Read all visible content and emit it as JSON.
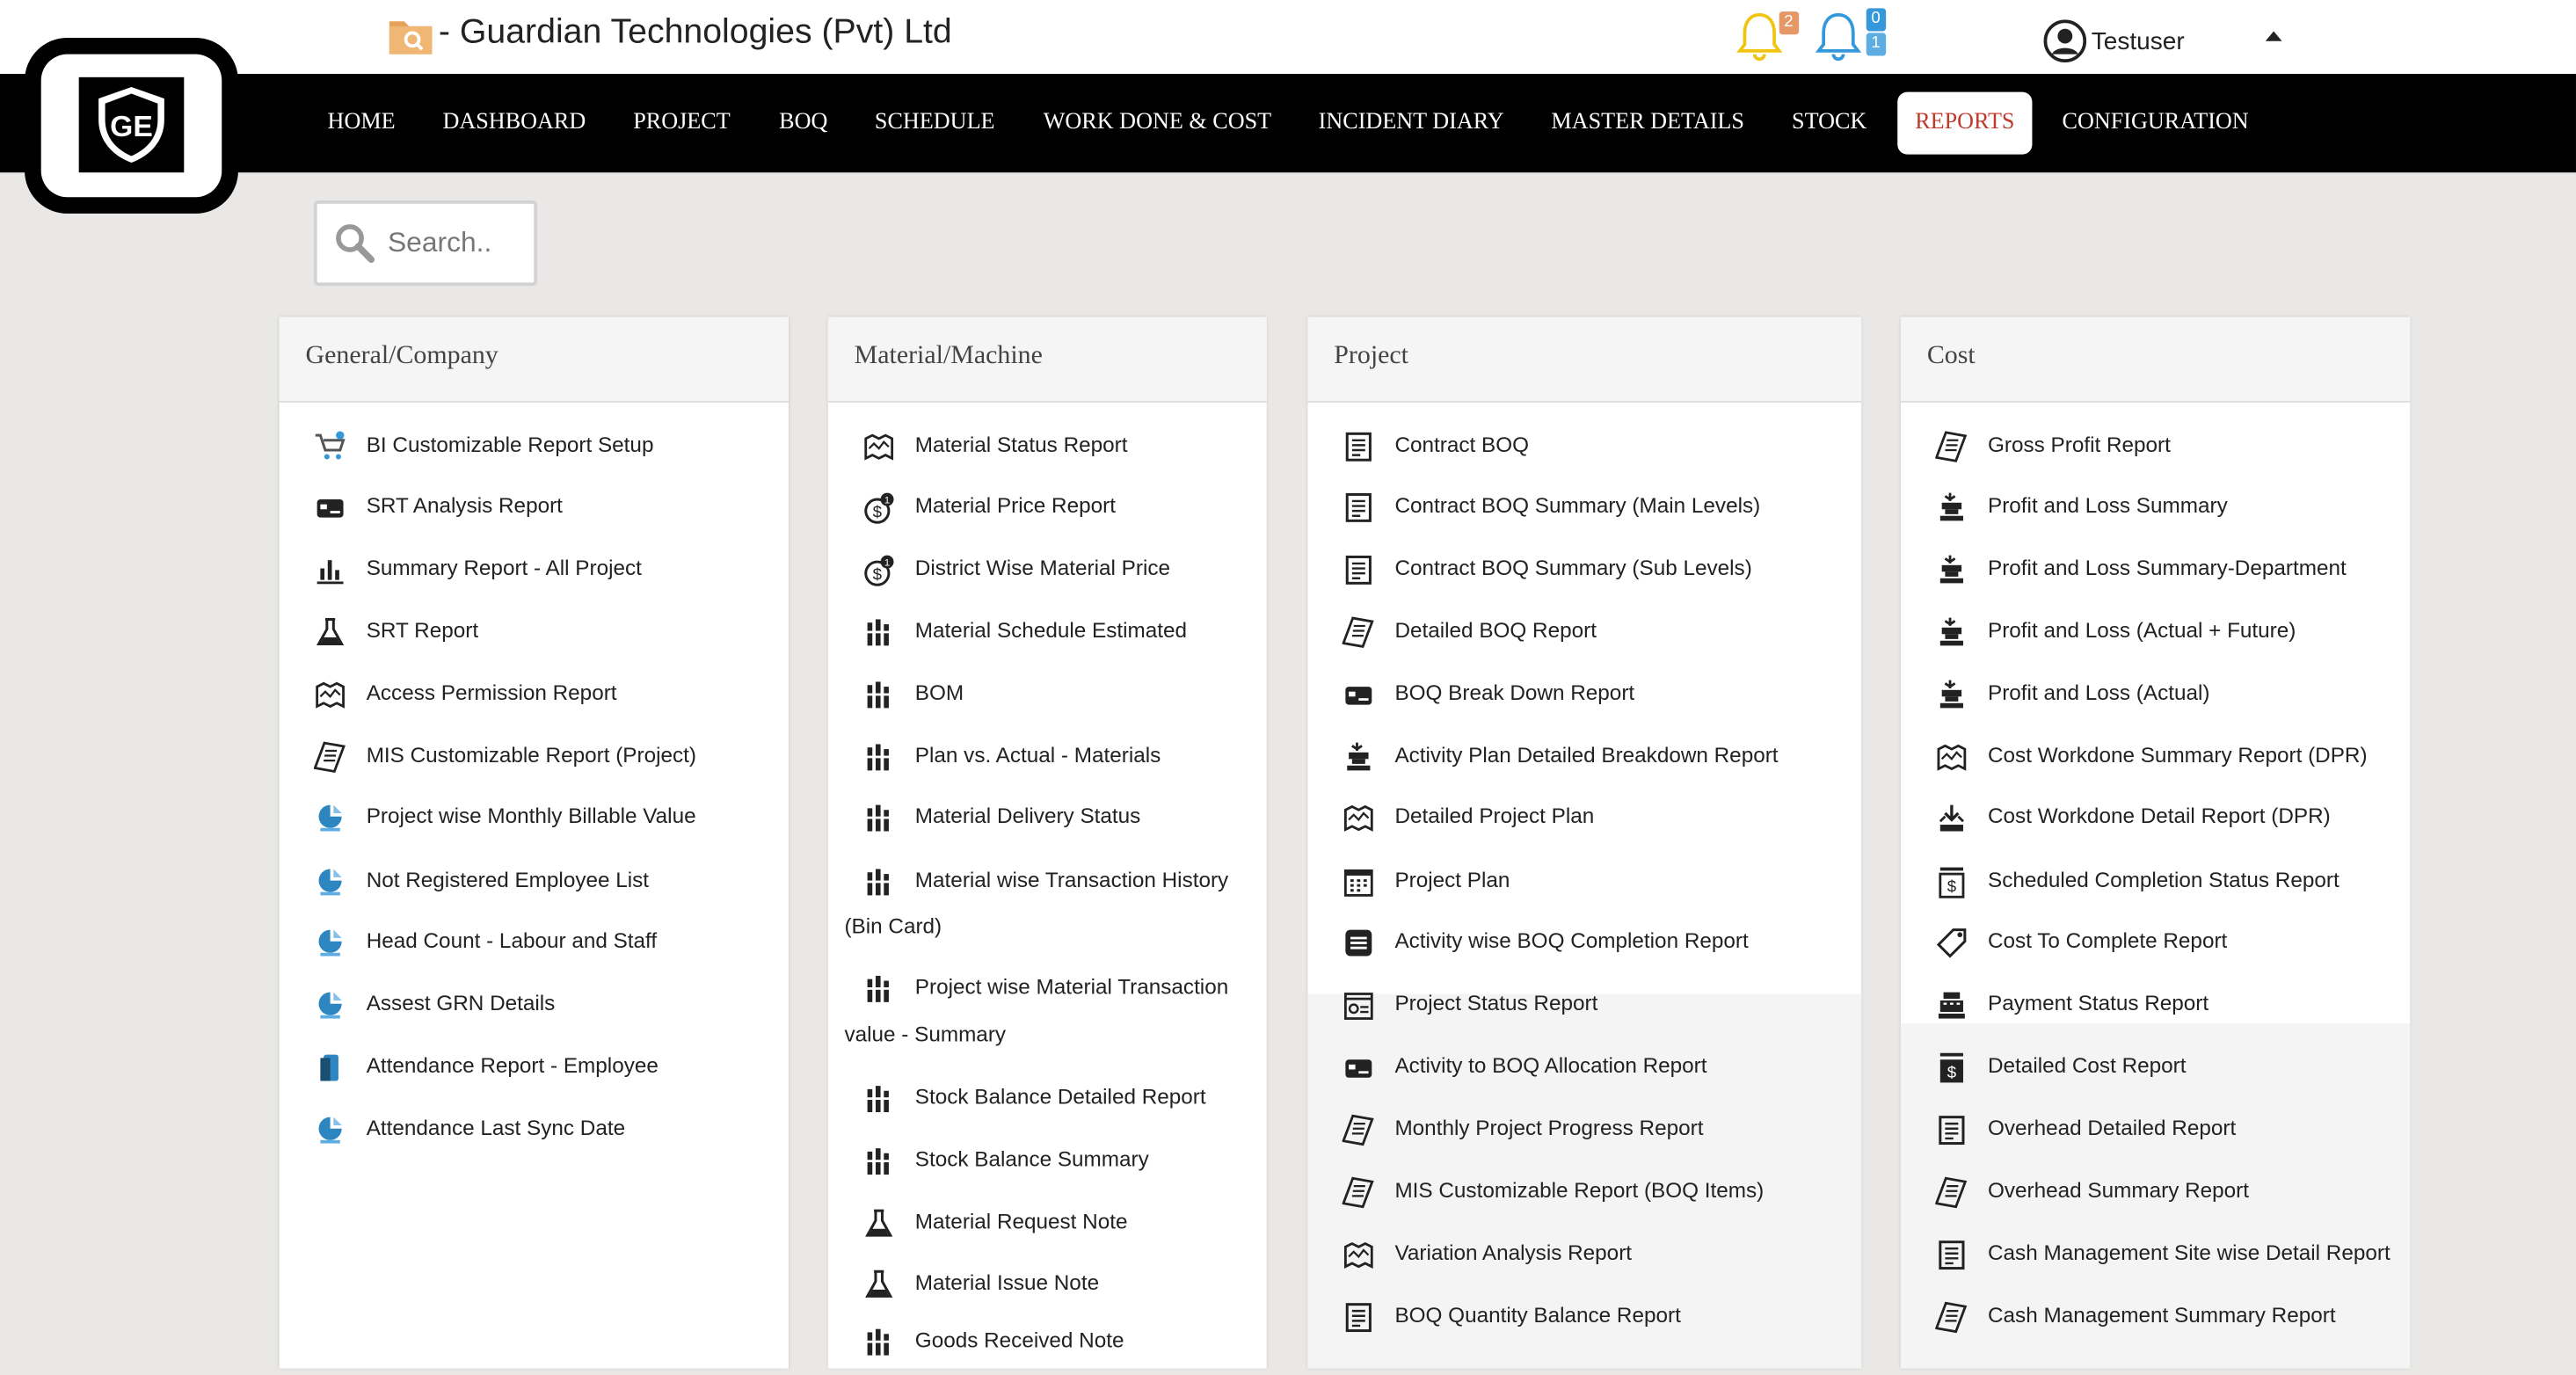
{
  "header": {
    "company_title": "- Guardian Technologies (Pvt) Ltd",
    "notification_count_1": "2",
    "notification_count_2a": "0",
    "notification_count_2b": "1",
    "username": "Testuser"
  },
  "nav": {
    "items": [
      "HOME",
      "DASHBOARD",
      "PROJECT",
      "BOQ",
      "SCHEDULE",
      "WORK DONE & COST",
      "INCIDENT DIARY",
      "MASTER DETAILS",
      "STOCK",
      "REPORTS",
      "CONFIGURATION"
    ],
    "active": "REPORTS"
  },
  "search": {
    "placeholder": "Search.."
  },
  "panels": [
    {
      "title": "General/Company",
      "items": [
        "BI Customizable Report Setup",
        "SRT Analysis Report",
        "Summary Report - All Project",
        "SRT Report",
        "Access Permission Report",
        "MIS Customizable Report (Project)",
        "Project wise Monthly Billable Value",
        "Not Registered Employee List",
        "Head Count - Labour and Staff",
        "Assest GRN Details",
        "Attendance Report - Employee",
        "Attendance Last Sync Date"
      ]
    },
    {
      "title": "Material/Machine",
      "items": [
        "Material Status Report",
        "Material Price Report",
        "District Wise Material Price",
        "Material Schedule Estimated",
        "BOM",
        "Plan vs. Actual - Materials",
        "Material Delivery Status",
        "Material wise Transaction History",
        "(Bin Card)",
        "Project wise Material Transaction",
        "value - Summary",
        "Stock Balance Detailed Report",
        "Stock Balance Summary",
        "Material Request Note",
        "Material Issue Note",
        "Goods Received Note"
      ]
    },
    {
      "title": "Project",
      "items": [
        "Contract BOQ",
        "Contract BOQ Summary (Main Levels)",
        "Contract BOQ Summary (Sub Levels)",
        "Detailed BOQ Report",
        "BOQ Break Down Report",
        "Activity Plan Detailed Breakdown Report",
        "Detailed Project Plan",
        "Project Plan",
        "Activity wise BOQ Completion Report",
        "Project Status Report",
        "Activity to BOQ Allocation Report",
        "Monthly Project Progress Report",
        "MIS Customizable Report (BOQ Items)",
        "Variation Analysis Report",
        "BOQ Quantity Balance Report"
      ]
    },
    {
      "title": "Cost",
      "items": [
        "Gross Profit Report",
        "Profit and Loss Summary",
        "Profit and Loss Summary-Department",
        "Profit and Loss (Actual + Future)",
        "Profit and Loss (Actual)",
        "Cost Workdone Summary Report (DPR)",
        "Cost Workdone Detail Report (DPR)",
        "Scheduled Completion Status Report",
        "Cost To Complete Report",
        "Payment Status Report",
        "Detailed Cost Report",
        "Overhead Detailed Report",
        "Overhead Summary Report",
        "Cash Management Site wise Detail Report",
        "Cash Management Summary Report"
      ]
    }
  ],
  "colors": {
    "accent_active": "#c0392b",
    "nav_bg": "#000000",
    "bell_yellow": "#f1c40f",
    "bell_blue": "#3498db"
  }
}
